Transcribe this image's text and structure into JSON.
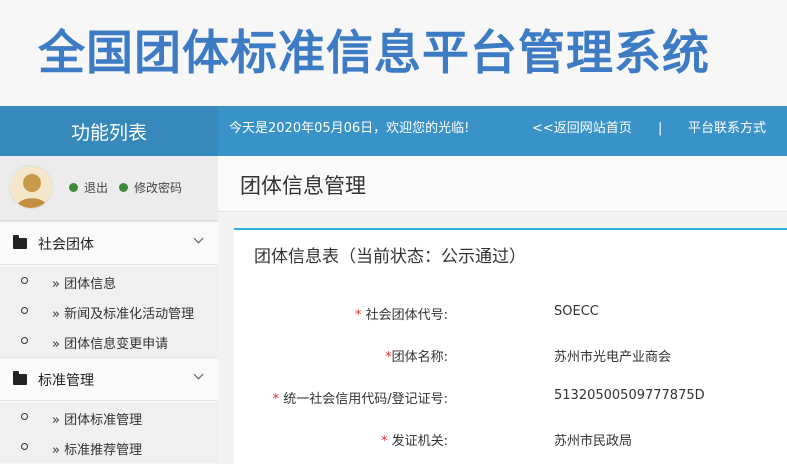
{
  "banner": {
    "title": "全国团体标准信息平台管理系统"
  },
  "topbar": {
    "function_list": "功能列表",
    "welcome": "今天是2020年05月06日，欢迎您的光临!",
    "back_home": "<<返回网站首页",
    "separator": "|",
    "contact": "平台联系方式"
  },
  "user": {
    "logout": "退出",
    "change_password": "修改密码"
  },
  "sidebar": {
    "groups": [
      {
        "label": "社会团体",
        "items": [
          "» 团体信息",
          "» 新闻及标准化活动管理",
          "» 团体信息变更申请"
        ]
      },
      {
        "label": "标准管理",
        "items": [
          "» 团体标准管理",
          "» 标准推荐管理"
        ]
      }
    ]
  },
  "main": {
    "page_title": "团体信息管理",
    "card_title": "团体信息表（当前状态：公示通过）",
    "required_mark": "*",
    "fields": [
      {
        "label": "社会团体代号:",
        "value": "SOECC"
      },
      {
        "label": "团体名称:",
        "value": "苏州市光电产业商会"
      },
      {
        "label": "统一社会信用代码/登记证号:",
        "value": "51320500509777875D"
      },
      {
        "label": "发证机关:",
        "value": "苏州市民政局"
      }
    ]
  },
  "colors": {
    "brand_blue": "#3d7cc4",
    "topbar": "#3a93c8",
    "accent_line": "#2fb3d8",
    "required": "#e03030"
  }
}
